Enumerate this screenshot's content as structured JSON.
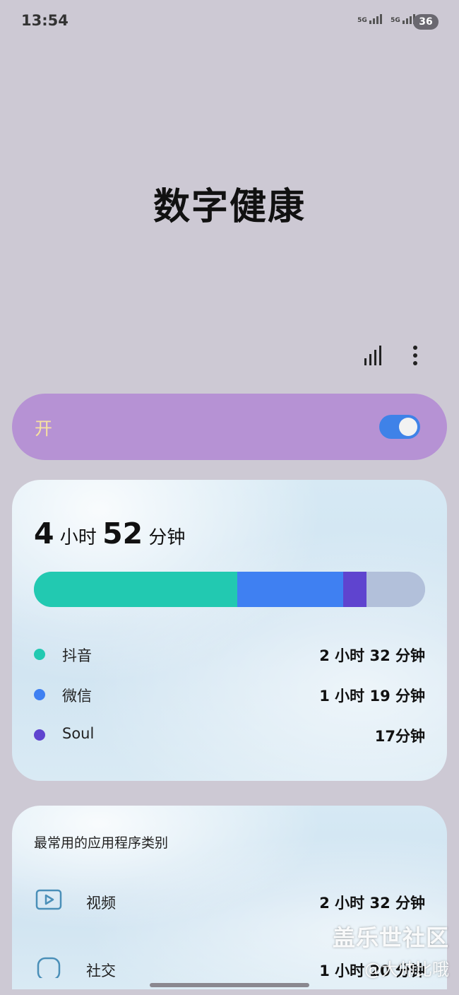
{
  "status_bar": {
    "time": "13:54",
    "network_1": "5G",
    "network_2": "5G",
    "battery": "36"
  },
  "page": {
    "title": "数字健康"
  },
  "toggle": {
    "label": "开",
    "on": true
  },
  "usage": {
    "total_hours": "4",
    "hours_unit": "小时",
    "total_minutes": "52",
    "minutes_unit": "分钟",
    "segments": [
      {
        "app": "抖音",
        "minutes": 152,
        "color": "#22c9b1"
      },
      {
        "app": "微信",
        "minutes": 79,
        "color": "#3f80f2"
      },
      {
        "app": "Soul",
        "minutes": 17,
        "color": "#5f44cf"
      },
      {
        "app": "other",
        "minutes": 44,
        "color": "#b2c0da"
      }
    ],
    "apps": [
      {
        "name": "抖音",
        "duration": "2 小时 32 分钟",
        "color": "#22c9b1"
      },
      {
        "name": "微信",
        "duration": "1 小时 19 分钟",
        "color": "#3f80f2"
      },
      {
        "name": "Soul",
        "duration": "17分钟",
        "color": "#5f44cf"
      }
    ]
  },
  "categories": {
    "title": "最常用的应用程序类别",
    "items": [
      {
        "name": "视频",
        "duration": "2 小时 32 分钟",
        "icon": "video-icon"
      },
      {
        "name": "社交",
        "duration": "1 小时 20 分钟",
        "icon": "chat-icon"
      }
    ]
  },
  "watermark": {
    "line1": "盖乐世社区",
    "line2": "@大帅比哦"
  }
}
